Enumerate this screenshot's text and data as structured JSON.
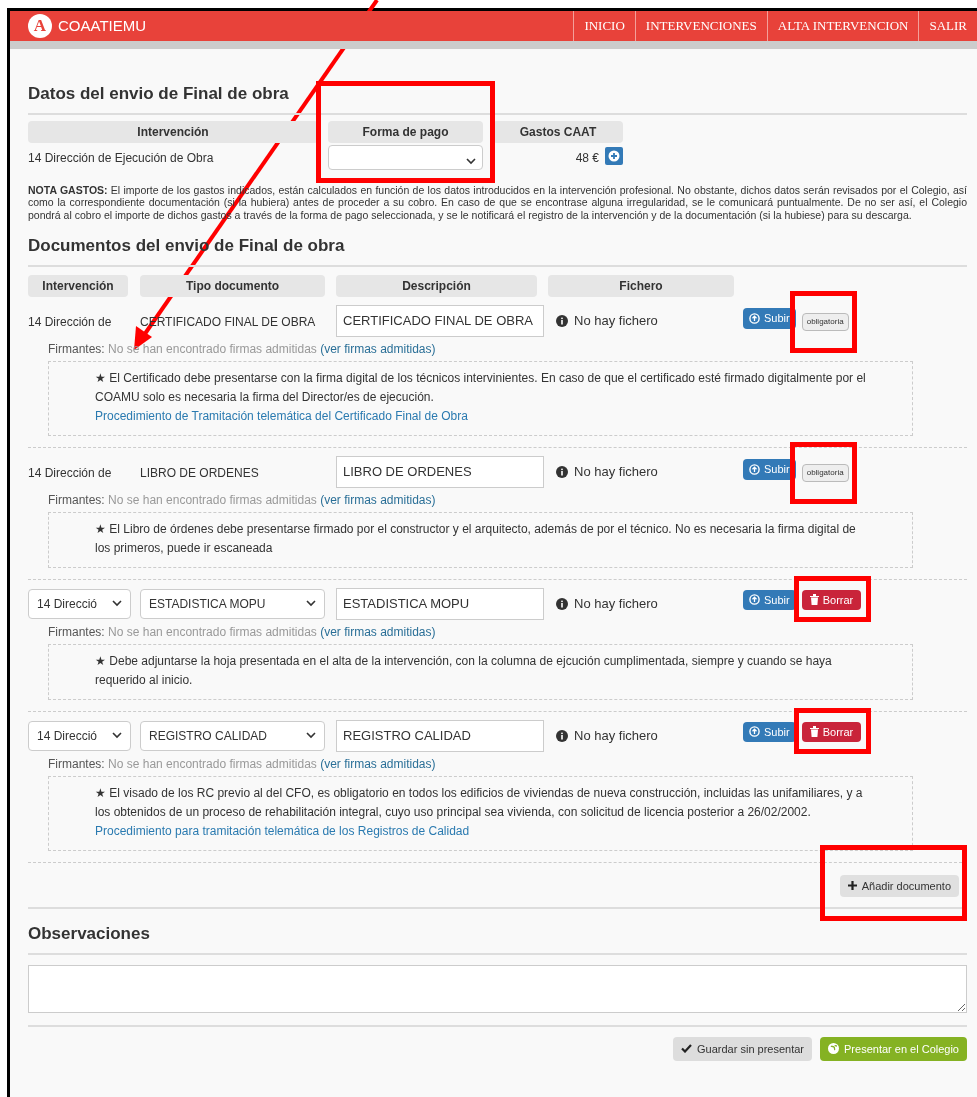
{
  "header": {
    "logo_letter": "A",
    "brand": "COAATIEMU",
    "nav": [
      {
        "label": "INICIO"
      },
      {
        "label": "INTERVENCIONES"
      },
      {
        "label": "ALTA INTERVENCION"
      },
      {
        "label": "SALIR"
      }
    ]
  },
  "envio": {
    "title": "Datos del envio de Final de obra",
    "columns": [
      "Intervención",
      "Forma de pago",
      "Gastos CAAT"
    ],
    "intervencion": "14 Dirección de Ejecución de Obra",
    "gastos": "48 €"
  },
  "nota": "**NOTA GASTOS:** El importe de los gastos indicados, están calculados en función de los datos introducidos en la intervención profesional. No obstante, dichos datos serán revisados por el Colegio, así como la correspondiente documentación (si la hubiera) antes de proceder a su cobro. En caso de que se encontrase alguna irregularidad, se le comunicará puntualmente. De no ser así, el Colegio pondrá al cobro el importe de dichos gastos a través de la forma de pago seleccionada, y se le notificará el registro de la intervención y de la documentación (si la hubiese) para su descarga.",
  "documentos": {
    "title": "Documentos del envio de Final de obra",
    "columns": [
      "Intervención",
      "Tipo documento",
      "Descripción",
      "Fichero"
    ],
    "items": [
      {
        "kind": "fixed",
        "intervencion": "14 Dirección de",
        "tipo": "CERTIFICADO FINAL DE OBRA",
        "descripcion": "CERTIFICADO FINAL DE OBRA",
        "fichero": "No hay fichero",
        "upload": "Subir",
        "action": {
          "kind": "badge",
          "label": "obligatoria"
        },
        "firmantes_label": "Firmantes:",
        "firmantes_text": "No se han encontrado firmas admitidas",
        "firmantes_link": "(ver firmas admitidas)",
        "note": "★ El Certificado debe presentarse con la firma digital de los técnicos intervinientes. En caso de que el certificado esté firmado digitalmente por el COAMU solo es necesaria la firma del Director/es de ejecución.",
        "link": "Procedimiento de Tramitación telemática del Certificado Final de Obra"
      },
      {
        "kind": "fixed",
        "intervencion": "14 Dirección de",
        "tipo": "LIBRO DE ORDENES",
        "descripcion": "LIBRO DE ORDENES",
        "fichero": "No hay fichero",
        "upload": "Subir",
        "action": {
          "kind": "badge",
          "label": "obligatoria"
        },
        "firmantes_label": "Firmantes:",
        "firmantes_text": "No se han encontrado firmas admitidas",
        "firmantes_link": "(ver firmas admitidas)",
        "note": "★ El Libro de órdenes debe presentarse firmado por el constructor y el arquitecto, además de por el técnico. No es necesaria la firma digital de los primeros, puede ir escaneada"
      },
      {
        "kind": "select",
        "intervencion": "14 Direcció",
        "tipo": "ESTADISTICA MOPU",
        "descripcion": "ESTADISTICA MOPU",
        "fichero": "No hay fichero",
        "upload": "Subir",
        "action": {
          "kind": "delete",
          "label": "Borrar"
        },
        "firmantes_label": "Firmantes:",
        "firmantes_text": "No se han encontrado firmas admitidas",
        "firmantes_link": "(ver firmas admitidas)",
        "note": "★ Debe adjuntarse la hoja presentada en el alta de la intervención, con la columna de ejcución cumplimentada, siempre y cuando se haya requerido al inicio."
      },
      {
        "kind": "select",
        "intervencion": "14 Direcció",
        "tipo": "REGISTRO CALIDAD",
        "descripcion": "REGISTRO CALIDAD",
        "fichero": "No hay fichero",
        "upload": "Subir",
        "action": {
          "kind": "delete",
          "label": "Borrar"
        },
        "firmantes_label": "Firmantes:",
        "firmantes_text": "No se han encontrado firmas admitidas",
        "firmantes_link": "(ver firmas admitidas)",
        "note": "★ El visado de los RC previo al del CFO, es obligatorio en todos los edificios de viviendas de nueva construcción, incluidas las unifamiliares, y a los obtenidos de un proceso de rehabilitación integral, cuyo uso principal sea vivienda, con solicitud de licencia posterior a 26/02/2002.",
        "link": "Procedimiento para tramitación telemática de los Registros de Calidad"
      }
    ],
    "add_button": "Añadir documento"
  },
  "observaciones": {
    "title": "Observaciones"
  },
  "buttons": [
    {
      "kind": "save",
      "label": "Guardar sin presentar"
    },
    {
      "kind": "submit",
      "label": "Presentar en el Colegio"
    }
  ]
}
